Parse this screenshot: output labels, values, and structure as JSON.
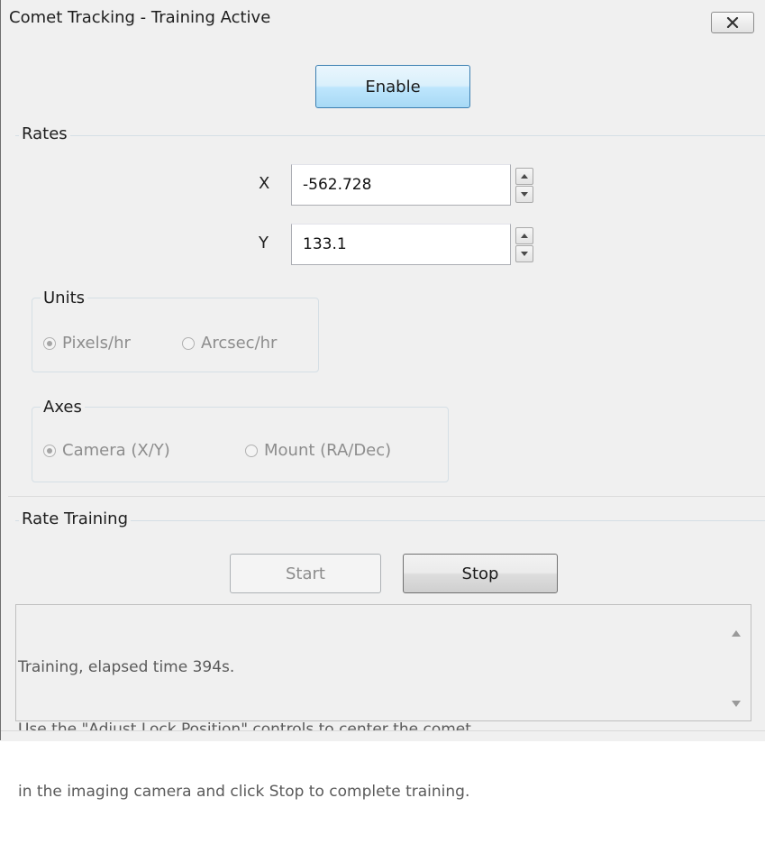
{
  "window": {
    "title": "Comet Tracking - Training Active"
  },
  "buttons": {
    "enable": "Enable",
    "start": "Start",
    "stop": "Stop"
  },
  "rates": {
    "section_label": "Rates",
    "x_label": "X",
    "x_value": "-562.728",
    "y_label": "Y",
    "y_value": "133.1"
  },
  "units": {
    "group_label": "Units",
    "options": [
      {
        "label": "Pixels/hr",
        "checked": true
      },
      {
        "label": "Arcsec/hr",
        "checked": false
      }
    ]
  },
  "axes": {
    "group_label": "Axes",
    "options": [
      {
        "label": "Camera (X/Y)",
        "checked": true
      },
      {
        "label": "Mount (RA/Dec)",
        "checked": false
      }
    ]
  },
  "training": {
    "section_label": "Rate Training",
    "log_lines": [
      "Training, elapsed time 394s.",
      "Use the \"Adjust Lock Position\" controls to center the comet",
      "in the imaging camera and click Stop to complete training."
    ]
  },
  "icons": {
    "close": "close-icon",
    "spin_up": "spin-up-arrow-icon",
    "spin_down": "spin-down-arrow-icon",
    "scroll_up": "scroll-up-arrow-icon",
    "scroll_down": "scroll-down-arrow-icon"
  },
  "colors": {
    "accent_button_border": "#3c7fb1",
    "window_bg": "#f0f0f0",
    "disabled_text": "#8d8d8d"
  }
}
